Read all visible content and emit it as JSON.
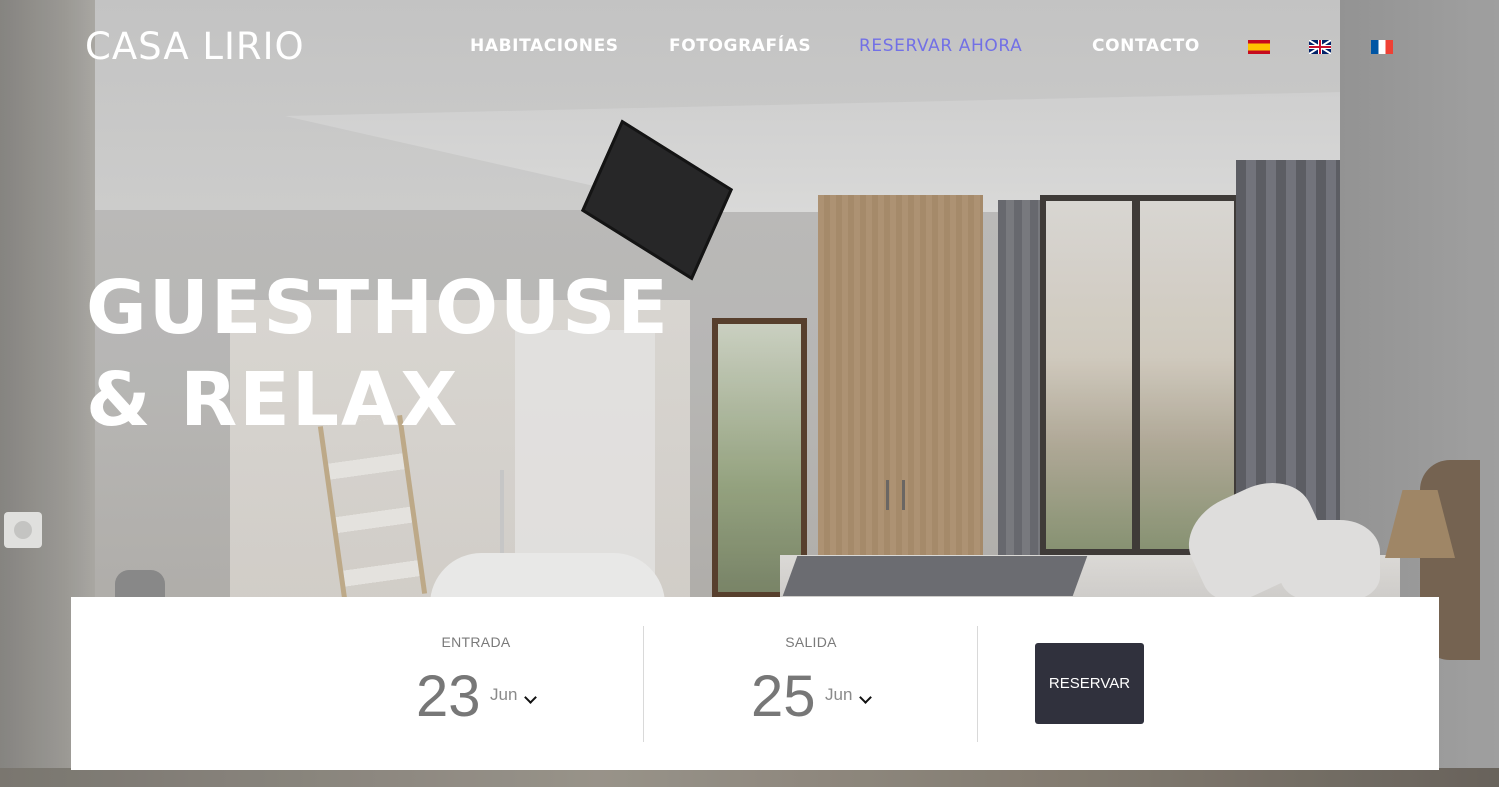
{
  "header": {
    "logo": "CASA LIRIO",
    "nav": [
      {
        "label": "HABITACIONES",
        "active": false
      },
      {
        "label": "FOTOGRAFÍAS",
        "active": false
      },
      {
        "label": "RESERVAR AHORA",
        "active": true
      },
      {
        "label": "CONTACTO",
        "active": false
      }
    ],
    "languages": [
      {
        "icon": "spain-flag-icon"
      },
      {
        "icon": "uk-flag-icon"
      },
      {
        "icon": "france-flag-icon"
      }
    ],
    "active_color": "#7270e6"
  },
  "hero": {
    "line1": "GUESTHOUSE",
    "line2": "& RELAX"
  },
  "booking": {
    "checkin": {
      "label": "ENTRADA",
      "day": "23",
      "month": "Jun"
    },
    "checkout": {
      "label": "SALIDA",
      "day": "25",
      "month": "Jun"
    },
    "button": "RESERVAR",
    "button_color": "#30313d"
  }
}
